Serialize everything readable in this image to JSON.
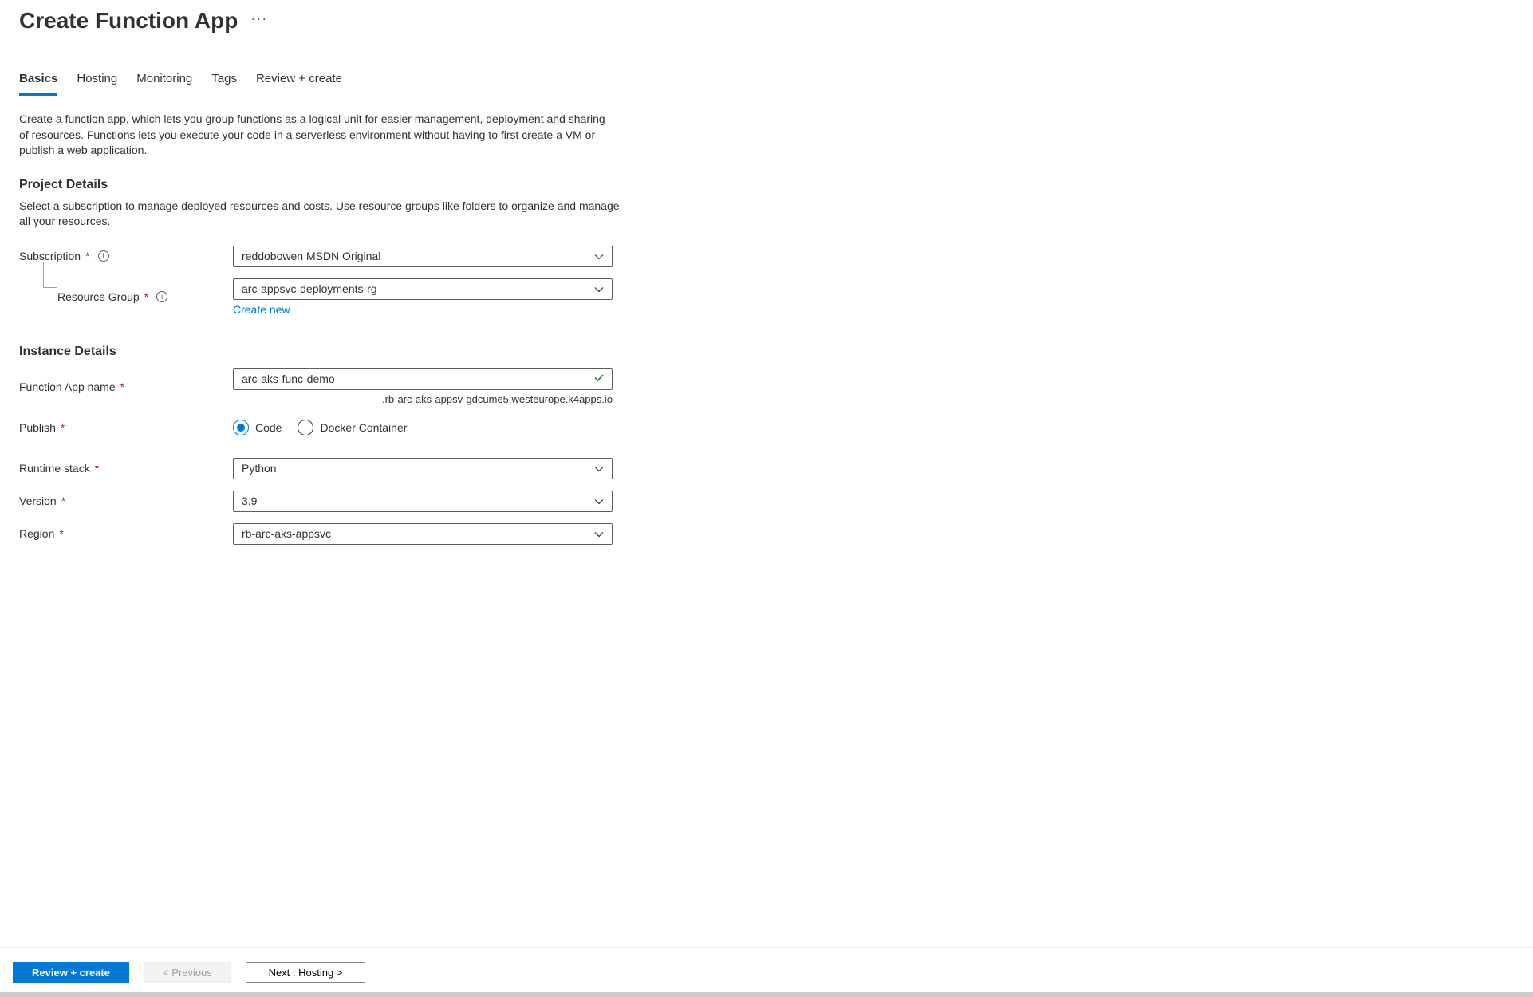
{
  "header": {
    "title": "Create Function App"
  },
  "tabs": [
    {
      "label": "Basics",
      "active": true
    },
    {
      "label": "Hosting",
      "active": false
    },
    {
      "label": "Monitoring",
      "active": false
    },
    {
      "label": "Tags",
      "active": false
    },
    {
      "label": "Review + create",
      "active": false
    }
  ],
  "intro": "Create a function app, which lets you group functions as a logical unit for easier management, deployment and sharing of resources. Functions lets you execute your code in a serverless environment without having to first create a VM or publish a web application.",
  "project_details": {
    "title": "Project Details",
    "description": "Select a subscription to manage deployed resources and costs. Use resource groups like folders to organize and manage all your resources.",
    "subscription_label": "Subscription",
    "subscription_value": "reddobowen MSDN Original",
    "resource_group_label": "Resource Group",
    "resource_group_value": "arc-appsvc-deployments-rg",
    "create_new_label": "Create new"
  },
  "instance_details": {
    "title": "Instance Details",
    "app_name_label": "Function App name",
    "app_name_value": "arc-aks-func-demo",
    "app_name_suffix": ".rb-arc-aks-appsv-gdcume5.westeurope.k4apps.io",
    "publish_label": "Publish",
    "publish_options": {
      "code": "Code",
      "docker": "Docker Container"
    },
    "runtime_label": "Runtime stack",
    "runtime_value": "Python",
    "version_label": "Version",
    "version_value": "3.9",
    "region_label": "Region",
    "region_value": "rb-arc-aks-appsvc"
  },
  "footer": {
    "review_create": "Review + create",
    "previous": "< Previous",
    "next": "Next : Hosting >"
  }
}
